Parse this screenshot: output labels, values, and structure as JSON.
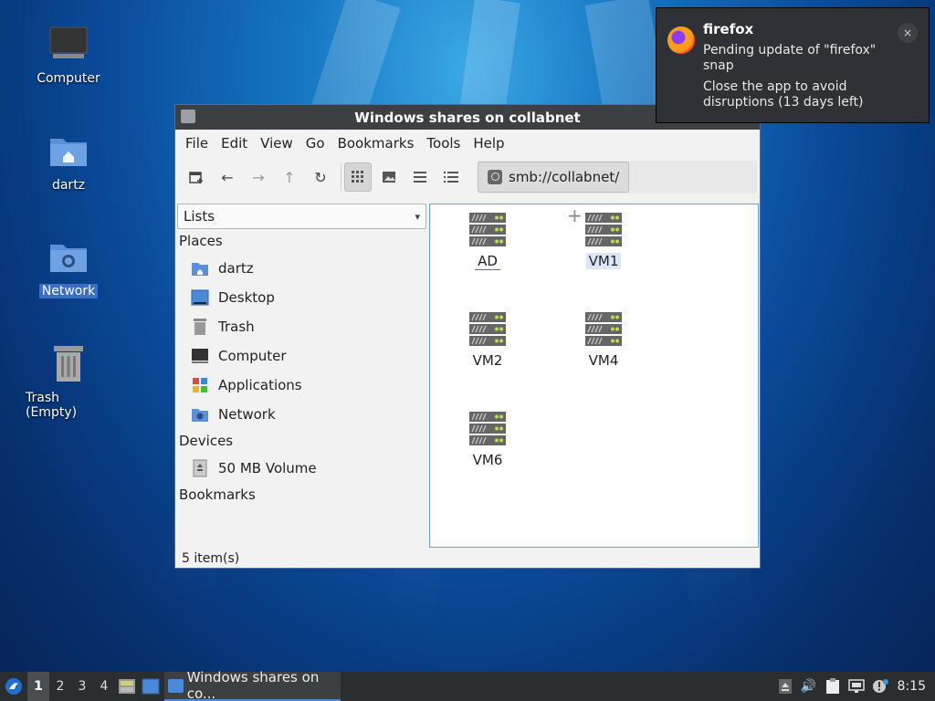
{
  "desktop": {
    "icons": [
      {
        "label": "Computer"
      },
      {
        "label": "dartz"
      },
      {
        "label": "Network"
      },
      {
        "label": "Trash (Empty)"
      }
    ]
  },
  "window": {
    "title": "Windows shares on collabnet",
    "menu": [
      "File",
      "Edit",
      "View",
      "Go",
      "Bookmarks",
      "Tools",
      "Help"
    ],
    "address": "smb://collabnet/",
    "side_pane_mode": "Lists",
    "sections": {
      "places": "Places",
      "devices": "Devices",
      "bookmarks": "Bookmarks"
    },
    "places": [
      "dartz",
      "Desktop",
      "Trash",
      "Computer",
      "Applications",
      "Network"
    ],
    "devices": [
      "50 MB Volume"
    ],
    "files": [
      "AD",
      "VM1",
      "VM2",
      "VM4",
      "VM6"
    ],
    "status": "5 item(s)"
  },
  "notification": {
    "app": "firefox",
    "line1": "Pending update of \"firefox\" snap",
    "line2": "Close the app to avoid disruptions (13 days left)",
    "close": "×"
  },
  "taskbar": {
    "workspaces": [
      "1",
      "2",
      "3",
      "4"
    ],
    "active_task": "Windows shares on co...",
    "clock": "8:15"
  },
  "colors": {
    "accent": "#3b6fc7",
    "titlebar": "#3c4043",
    "taskbar": "#2b2e31"
  }
}
